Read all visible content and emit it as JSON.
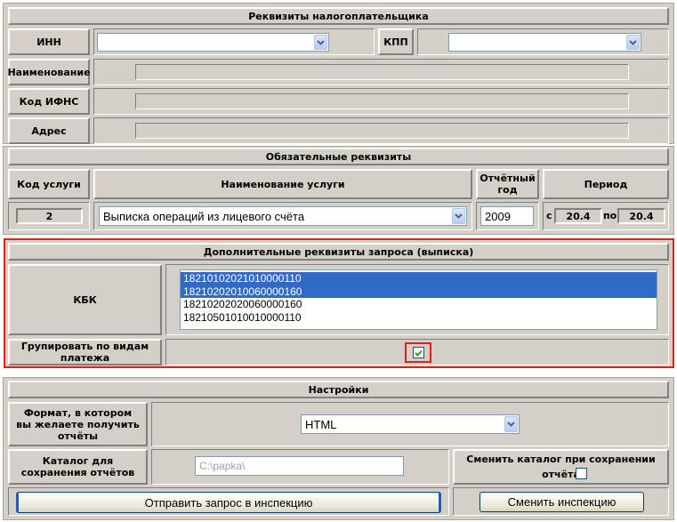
{
  "taxpayer": {
    "header": "Реквизиты налогоплательщика",
    "inn_label": "ИНН",
    "kpp_label": "КПП",
    "name_label": "Наименование",
    "ifns_label": "Код ИФНС",
    "address_label": "Адрес"
  },
  "required": {
    "header": "Обязательные реквизиты",
    "service_code_label": "Код услуги",
    "service_name_label": "Наименование услуги",
    "year_label": "Отчётный год",
    "period_label": "Период",
    "service_code": "2",
    "service_name": "Выписка операций из лицевого счёта",
    "year": "2009",
    "from_label": "с",
    "from_value": "20.4",
    "to_label": "по",
    "to_value": "20.4"
  },
  "additional": {
    "header": "Дополнительные реквизиты запроса (выписка)",
    "kbk_label": "КБК",
    "kbk_items": [
      {
        "code": "18210102021010000110",
        "selected": true
      },
      {
        "code": "18210202010060000160",
        "selected": true
      },
      {
        "code": "18210202020060000160",
        "selected": false
      },
      {
        "code": "18210501010010000110",
        "selected": false
      }
    ],
    "group_label": "Групировать по видам платежа",
    "group_checked": true
  },
  "settings": {
    "header": "Настройки",
    "format_label": "Формат, в котором вы желаете получить отчёты",
    "format_value": "HTML",
    "dir_label": "Каталог для сохранения отчётов",
    "dir_value": "C:\\papka\\",
    "change_dir_label": "Сменить каталог при сохранении отчёта",
    "change_dir_checked": false
  },
  "buttons": {
    "send": "Отправить запрос в инспекцию",
    "change_inspection": "Сменить инспекцию"
  },
  "colors": {
    "panel": "#d4d0c8",
    "highlight": "#e0201c",
    "selection": "#316ac5"
  }
}
